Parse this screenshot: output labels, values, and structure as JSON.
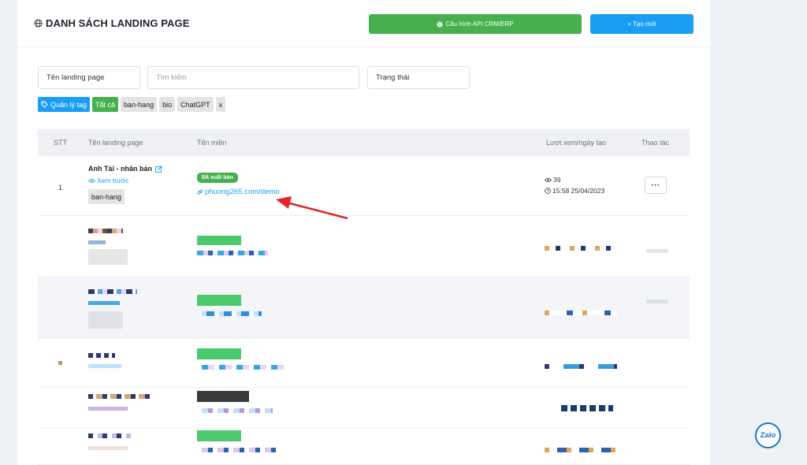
{
  "header": {
    "title": "DANH SÁCH LANDING PAGE",
    "title_icon": "globe-icon",
    "api_button": "Cấu hình API CRM/ERP",
    "new_button": "+ Tạo mới"
  },
  "filters": {
    "name_value": "Tên landing page",
    "search_placeholder": "Tìm kiếm",
    "status_value": "Trạng thái"
  },
  "tags": {
    "manage": "Quản lý tag",
    "items": [
      "Tất cả",
      "ban-hang",
      "bio",
      "ChatGPT",
      "x"
    ]
  },
  "table": {
    "headers": [
      "STT",
      "Tên landing page",
      "Tên miền",
      "Lượt xem/ngày tạo",
      "Thao tác"
    ],
    "rows": [
      {
        "stt": "1",
        "name": "Anh Tài - nhân bản",
        "preview": "Xem trước",
        "tag": "ban-hang",
        "status": "Đã xuất bản",
        "domain": "phuong265.com/demo",
        "views": "39",
        "created": "15:58 25/04/2023",
        "action": "···"
      }
    ]
  },
  "zalo": "Zalo",
  "colors": {
    "green": "#46b04f",
    "blue": "#1a9ef5",
    "arrow": "#e0262b"
  }
}
